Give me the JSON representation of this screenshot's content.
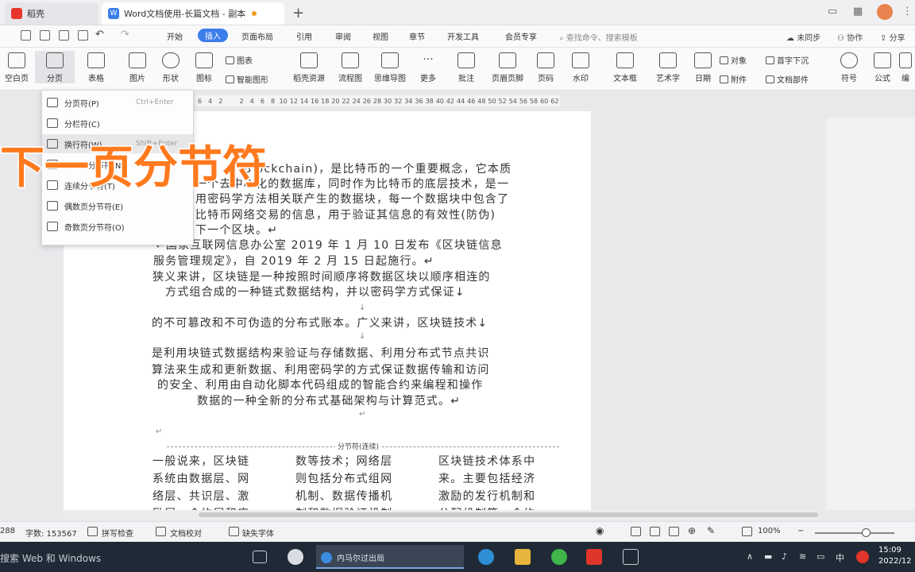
{
  "tabs": {
    "home": "稻壳",
    "doc": "Word文档使用-长篇文档 - 副本",
    "new_tab": "+"
  },
  "menu": {
    "items": [
      "开始",
      "插入",
      "页面布局",
      "引用",
      "审阅",
      "视图",
      "章节",
      "开发工具",
      "会员专享"
    ],
    "active": "插入",
    "search": "查找命令、搜索模板",
    "right": [
      "未同步",
      "协作",
      "分享"
    ]
  },
  "ribbon": {
    "big": [
      "空白页",
      "分页",
      "表格",
      "图片",
      "形状",
      "图标",
      "稻壳资源",
      "流程图",
      "思维导图",
      "更多",
      "批注",
      "页眉页脚",
      "页码",
      "水印",
      "文本框",
      "艺术字",
      "日期",
      "符号",
      "公式"
    ],
    "small": [
      "图表",
      "智能图形",
      "对象",
      "首字下沉",
      "附件",
      "文档部件"
    ],
    "last_label": "编"
  },
  "ruler": [
    "6",
    "4",
    "2",
    "",
    "2",
    "4",
    "6",
    "8",
    "10",
    "12",
    "14",
    "16",
    "18",
    "20",
    "22",
    "24",
    "26",
    "28",
    "30",
    "32",
    "34",
    "36",
    "38",
    "40",
    "42",
    "44",
    "46",
    "48",
    "50",
    "52",
    "54",
    "56",
    "58",
    "60",
    "62"
  ],
  "dropdown": {
    "items": [
      {
        "label": "分页符(P)",
        "shortcut": "Ctrl+Enter"
      },
      {
        "label": "分栏符(C)",
        "shortcut": ""
      },
      {
        "label": "换行符(W)",
        "shortcut": "Shift+Enter"
      },
      {
        "label": "下一页分节符(N)",
        "shortcut": ""
      },
      {
        "label": "连续分节符(T)",
        "shortcut": ""
      },
      {
        "label": "偶数页分节符(E)",
        "shortcut": ""
      },
      {
        "label": "奇数页分节符(O)",
        "shortcut": ""
      }
    ]
  },
  "caption": "下一页分节符",
  "document": {
    "lines": [
      "(Blockchain)，是比特币的一个重要概念，它本质",
      "一个去中心化的数据库，同时作为比特币的底层技术，是一",
      "用密码学方法相关联产生的数据块，每一个数据块中包含了",
      "比特币网络交易的信息，用于验证其信息的有效性(防伪)",
      "下一个区块。↵",
      "↵国家互联网信息办公室 2019 年 1 月 10 日发布《区块链信息",
      "服务管理规定》，自 2019 年 2 月 15 日起施行。↵",
      "狭义来讲，区块链是一种按照时间顺序将数据区块以顺序相连的",
      "方式组合成的一种链式数据结构，并以密码学方式保证↓",
      "的不可篡改和不可伪造的分布式账本。广义来讲，区块链技术↓",
      "是利用块链式数据结构来验证与存储数据、利用分布式节点共识",
      "算法来生成和更新数据、利用密码学的方式保证数据传输和访问",
      "的安全、利用由自动化脚本代码组成的智能合约来编程和操作",
      "数据的一种全新的分布式基础架构与计算范式。↵"
    ],
    "section_label": "分节符(连续)",
    "columns": [
      [
        "一般说来，区块链",
        "系统由数据层、网",
        "络层、共识层、激",
        "励层、合约层和应"
      ],
      [
        "数等技术；网络层",
        "则包括分布式组网",
        "机制、数据传播机",
        "制和数据验证机制"
      ],
      [
        "区块链技术体系中",
        "来。主要包括经济",
        "激励的发行机制和",
        "分配机制等，合约"
      ]
    ]
  },
  "status": {
    "page": "288",
    "words": "字数: 153567",
    "spell": "拼写检查",
    "proof": "文档校对",
    "font": "缺失字体",
    "zoom": "100%"
  },
  "taskbar": {
    "search": "搜索 Web 和 Windows",
    "window": "内马尔过出局",
    "ime": "中",
    "time": "15:09",
    "date": "2022/12"
  }
}
